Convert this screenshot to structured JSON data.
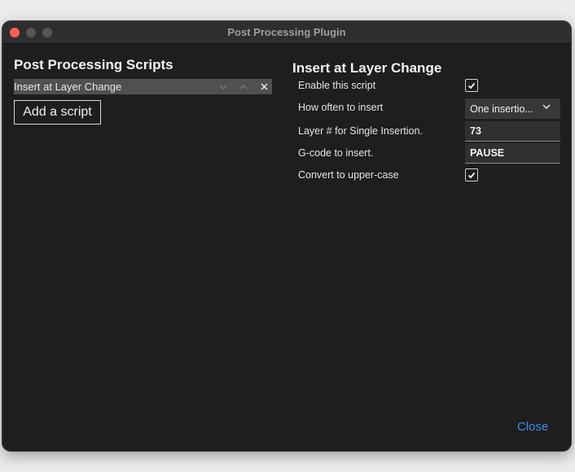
{
  "window": {
    "title": "Post Processing Plugin"
  },
  "left_panel": {
    "heading": "Post Processing Scripts",
    "scripts": [
      {
        "label": "Insert at Layer Change"
      }
    ],
    "add_button_label": "Add a script"
  },
  "right_panel": {
    "heading": "Insert at Layer Change",
    "settings": {
      "enable": {
        "label": "Enable this script",
        "checked": true
      },
      "how_often": {
        "label": "How often to insert",
        "value": "One insertio..."
      },
      "layer_number": {
        "label": "Layer # for Single Insertion.",
        "value": "73"
      },
      "gcode": {
        "label": "G-code to insert.",
        "value": "PAUSE"
      },
      "uppercase": {
        "label": "Convert to upper-case",
        "checked": true
      }
    }
  },
  "footer": {
    "close_label": "Close"
  },
  "colors": {
    "accent": "#3b8ce8",
    "window_bg": "#1e1e1f",
    "close_button": "#fe5f57"
  },
  "icons": {
    "move_down": "chevron-down-icon",
    "move_up": "chevron-up-icon",
    "remove": "close-icon",
    "checkmark": "checkmark-icon"
  }
}
